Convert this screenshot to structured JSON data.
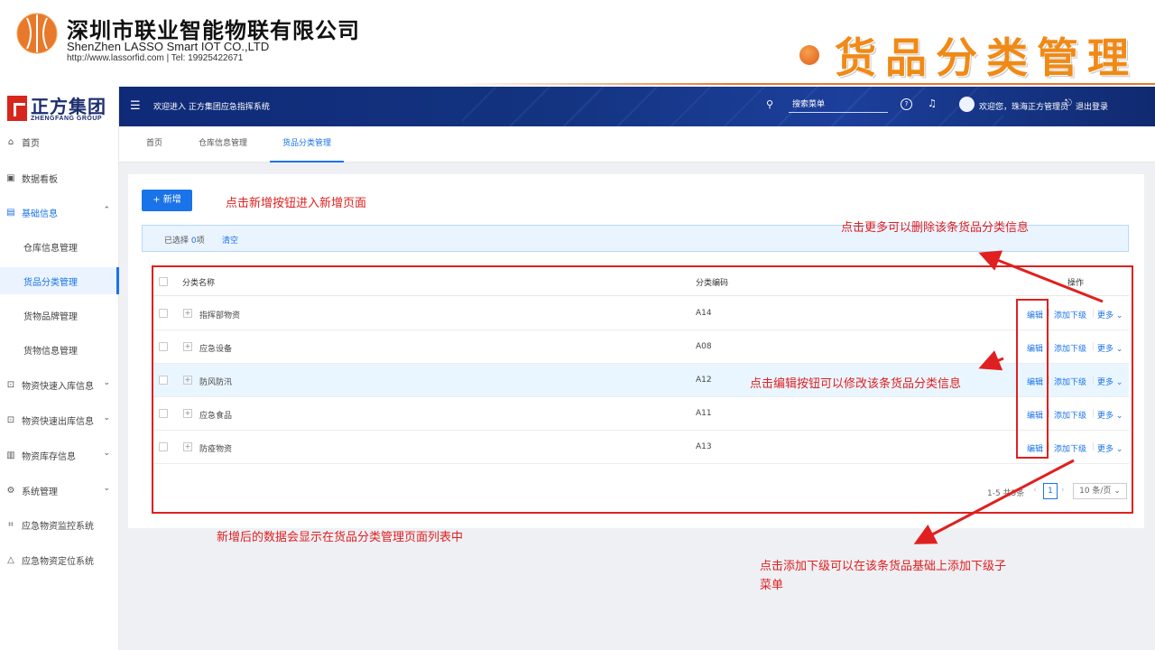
{
  "slide": {
    "company_cn": "深圳市联业智能物联有限公司",
    "company_en": "ShenZhen LASSO Smart IOT CO.,LTD",
    "company_contact": "http://www.lassorfid.com | Tel: 19925422671",
    "page_title": "货品分类管理"
  },
  "brand": {
    "name_cn": "正方集团",
    "name_en": "ZHENGFANG GROUP"
  },
  "topbar": {
    "system_welcome": "欢迎进入 正方集团应急指挥系统",
    "search_placeholder": "搜索菜单",
    "user_greeting": "欢迎您，珠海正方管理员",
    "logout": "退出登录"
  },
  "sidebar": {
    "items": [
      {
        "icon": "home-icon",
        "label": "首页"
      },
      {
        "icon": "dashboard-icon",
        "label": "数据看板"
      },
      {
        "icon": "info-icon",
        "label": "基础信息"
      },
      {
        "label": "仓库信息管理"
      },
      {
        "label": "货品分类管理"
      },
      {
        "label": "货物品牌管理"
      },
      {
        "label": "货物信息管理"
      },
      {
        "icon": "inbound-icon",
        "label": "物资快速入库信息"
      },
      {
        "icon": "outbound-icon",
        "label": "物资快速出库信息"
      },
      {
        "icon": "inventory-icon",
        "label": "物资库存信息"
      },
      {
        "icon": "settings-icon",
        "label": "系统管理"
      },
      {
        "icon": "monitor-icon",
        "label": "应急物资监控系统"
      },
      {
        "icon": "location-icon",
        "label": "应急物资定位系统"
      }
    ]
  },
  "tabs": [
    "首页",
    "仓库信息管理",
    "货品分类管理"
  ],
  "toolbar": {
    "add_label": "新增"
  },
  "selection": {
    "prefix": "已选择 ",
    "count": "0",
    "suffix": "项",
    "clear": "清空"
  },
  "table": {
    "headers": {
      "name": "分类名称",
      "code": "分类编码",
      "ops": "操作"
    },
    "rows": [
      {
        "name": "指挥部物资",
        "code": "A14"
      },
      {
        "name": "应急设备",
        "code": "A08"
      },
      {
        "name": "防风防汛",
        "code": "A12"
      },
      {
        "name": "应急食品",
        "code": "A11"
      },
      {
        "name": "防疫物资",
        "code": "A13"
      }
    ],
    "ops": {
      "edit": "编辑",
      "add_child": "添加下级",
      "more": "更多"
    }
  },
  "pagination": {
    "total": "1-5 共5条",
    "current": "1",
    "page_size": "10 条/页"
  },
  "annotations": {
    "add": "点击新增按钮进入新增页面",
    "more": "点击更多可以删除该条货品分类信息",
    "edit": "点击编辑按钮可以修改该条货品分类信息",
    "list": "新增后的数据会显示在货品分类管理页面列表中",
    "add_child_line1": "点击添加下级可以在该条货品基础上添加下级子",
    "add_child_line2": "菜单"
  },
  "colors": {
    "accent": "#1a73e8",
    "annotation": "#e02020",
    "title_orange": "#f08a16",
    "topbar": "#13337f"
  }
}
